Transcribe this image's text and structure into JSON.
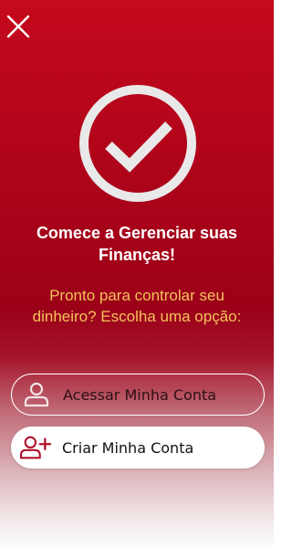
{
  "header": {
    "close_icon": "close-icon"
  },
  "hero": {
    "icon": "check-circle-icon",
    "title_line1": "Comece a Gerenciar suas",
    "title_line2": "Finanças!",
    "subtitle_line1": "Pronto para controlar seu",
    "subtitle_line2": "dinheiro? Escolha uma opção:"
  },
  "actions": {
    "login": {
      "label": "Acessar Minha Conta",
      "icon": "user-icon"
    },
    "signup": {
      "label": "Criar Minha Conta",
      "icon": "user-plus-icon"
    }
  },
  "colors": {
    "brand_red": "#a50219",
    "subtitle_gold": "#f4c25d",
    "icon_white": "#e9e9e9",
    "signup_icon_red": "#b0102a"
  }
}
